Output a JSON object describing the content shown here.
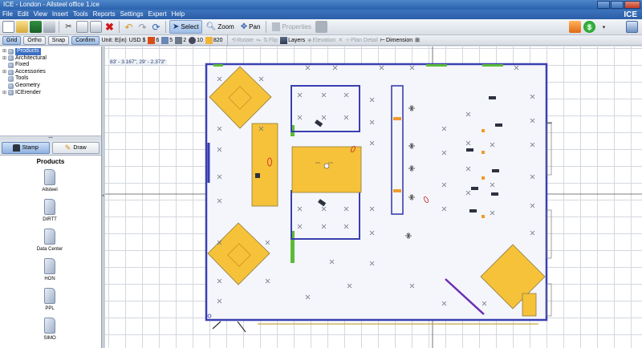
{
  "window": {
    "title": "ICE - London - Allsteel office 1.ice"
  },
  "menu": [
    "File",
    "Edit",
    "View",
    "Insert",
    "Tools",
    "Reports",
    "Settings",
    "Expert",
    "Help"
  ],
  "brand": "ICE",
  "toolbar": {
    "select": "Select",
    "zoom": "Zoom",
    "pan": "Pan",
    "properties": "Properties"
  },
  "toolbar2": {
    "grid": "Grid",
    "ortho": "Ortho",
    "snap": "Snap",
    "confirm": "Confirm",
    "unit": "Unit: E(in)",
    "currency": "USD $",
    "count_a": "6",
    "count_b": "5",
    "count_c": "2",
    "count_d": "10",
    "count_e": "820",
    "rotate": "Rotate",
    "flip": "Flip",
    "layers": "Layers",
    "elevation": "Elevation",
    "plan_detail": "Plan Detail",
    "dimension": "Dimension"
  },
  "tree": [
    "Products",
    "Architectural",
    "Fixed",
    "Accessories",
    "Tools",
    "Geometry",
    "ICErender"
  ],
  "tabs": {
    "stamp": "Stamp",
    "draw": "Draw"
  },
  "catalog": {
    "title": "Products",
    "items": [
      "Allsteel",
      "DIRTT",
      "Data Center",
      "HON",
      "PPL",
      "SIMO"
    ]
  },
  "status": {
    "coordinates": "83' - 3.167\", 29' - 2.373\""
  },
  "colors": {
    "wall": "#3a3fb0",
    "zone": "#f5c23a",
    "brand": "#2f67b2"
  }
}
